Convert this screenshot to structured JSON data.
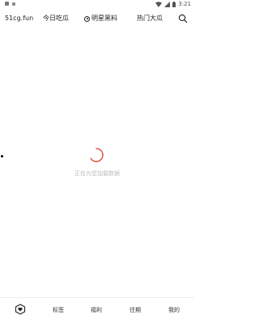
{
  "status_bar": {
    "time": "3:21"
  },
  "top_nav": {
    "site": "51cg.fun",
    "tabs": [
      "今日吃瓜",
      "明星黑料",
      "热门大瓜"
    ]
  },
  "loading": {
    "text": "正在为您加载数据"
  },
  "bottom_nav": {
    "items": [
      "标签",
      "福利",
      "往期",
      "我的"
    ]
  },
  "icons": {
    "search": "search-icon",
    "home": "home-icon",
    "star_dot": "dot-icon",
    "wifi": "wifi-icon",
    "signal": "signal-icon",
    "battery": "battery-icon"
  },
  "colors": {
    "spinner": "#e24a3b",
    "loading_text": "#bdbdbd"
  }
}
